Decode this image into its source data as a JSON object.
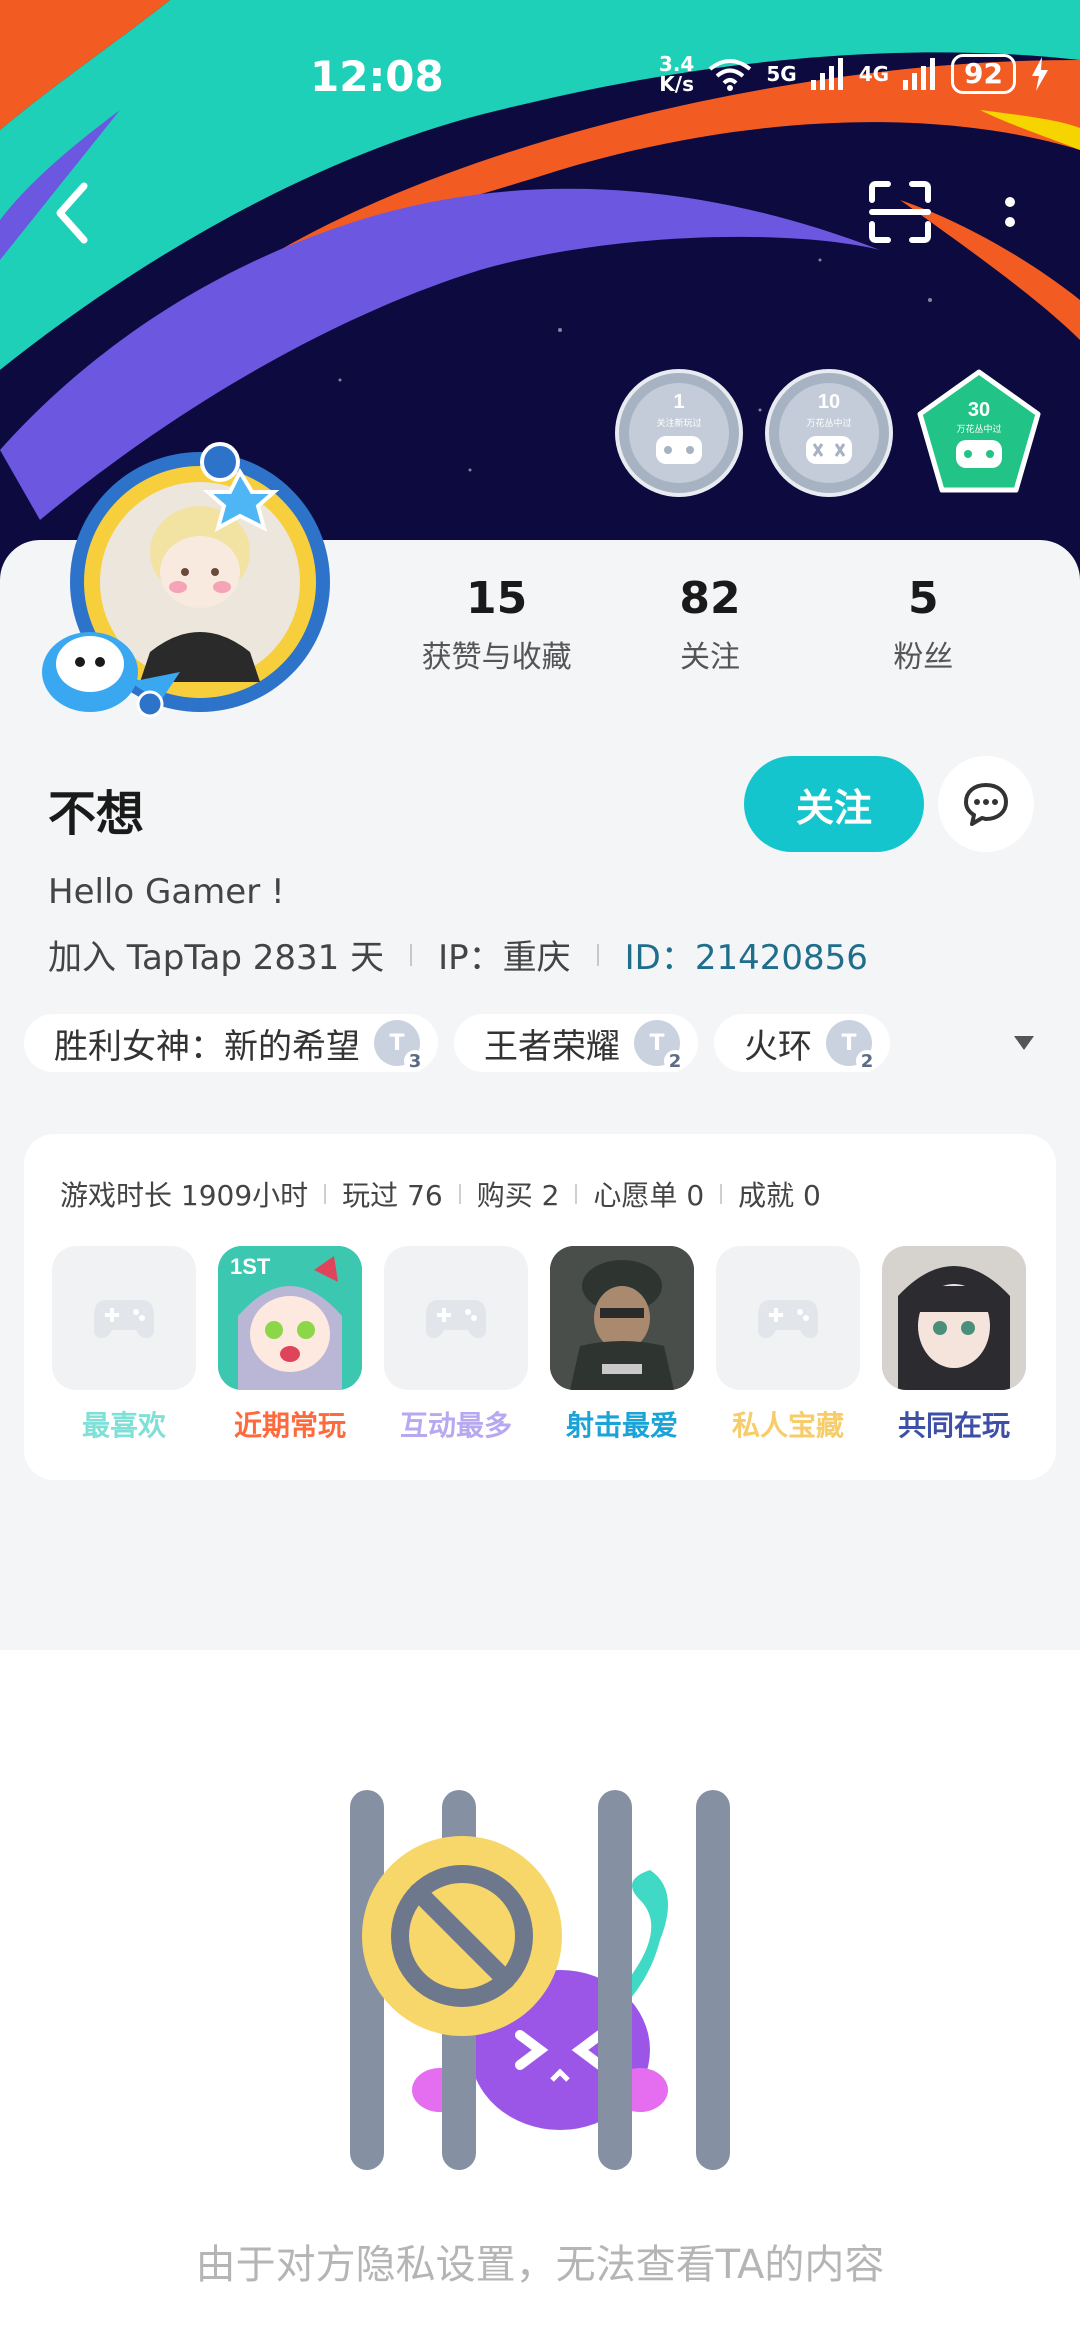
{
  "status_bar": {
    "time": "12:08",
    "speed_value": "3.4",
    "speed_unit": "K/s",
    "net1": "5G",
    "net2": "4G",
    "battery": "92"
  },
  "header": {
    "back_icon": "chevron-left-icon",
    "scan_icon": "scan-icon",
    "more_icon": "more-vertical-icon",
    "badges": [
      {
        "number": "1",
        "caption": "关注新玩过",
        "color": "#a7b3c3"
      },
      {
        "number": "10",
        "caption": "万花丛中过",
        "color": "#a7b3c3"
      },
      {
        "number": "30",
        "caption": "万花丛中过",
        "color": "#22c386"
      }
    ]
  },
  "profile": {
    "stats": [
      {
        "value": "15",
        "label": "获赞与收藏"
      },
      {
        "value": "82",
        "label": "关注"
      },
      {
        "value": "5",
        "label": "粉丝"
      }
    ],
    "username": "不想",
    "follow_label": "关注",
    "message_icon": "chat-bubble-icon",
    "bio": "Hello Gamer !",
    "joined": "加入 TapTap 2831 天",
    "ip": "IP：重庆",
    "id": "ID：21420856",
    "tags": [
      {
        "name": "胜利女神：新的希望",
        "level": "3"
      },
      {
        "name": "王者荣耀",
        "level": "2"
      },
      {
        "name": "火环",
        "level": "2"
      }
    ]
  },
  "games": {
    "stats": [
      "游戏时长 1909小时",
      "玩过 76",
      "购买 2",
      "心愿单 0",
      "成就 0"
    ],
    "items": [
      {
        "label": "最喜欢",
        "color": "#7ee0d6",
        "icon": "gamepad-icon"
      },
      {
        "label": "近期常玩",
        "color": "#ff6a3d",
        "icon": "game-cover-anime"
      },
      {
        "label": "互动最多",
        "color": "#b7a8f0",
        "icon": "gamepad-icon"
      },
      {
        "label": "射击最爱",
        "color": "#1aa3d6",
        "icon": "game-cover-soldier"
      },
      {
        "label": "私人宝藏",
        "color": "#f7cd6a",
        "icon": "gamepad-icon"
      },
      {
        "label": "共同在玩",
        "color": "#3e4fa8",
        "icon": "game-cover-girl"
      }
    ]
  },
  "privacy": {
    "message": "由于对方隐私设置，无法查看TA的内容"
  }
}
